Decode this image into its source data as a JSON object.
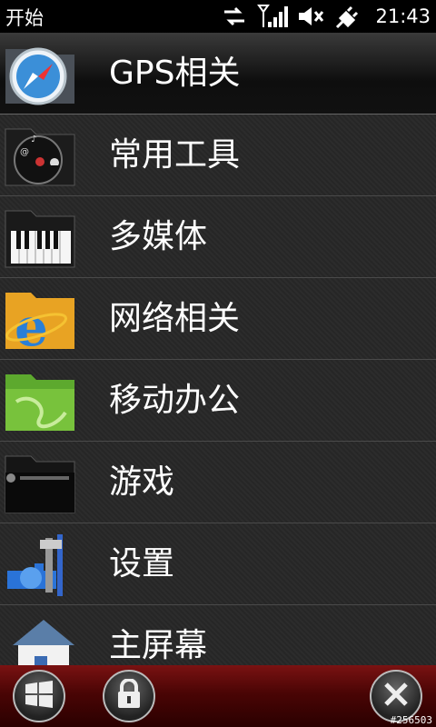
{
  "statusbar": {
    "title": "开始",
    "time": "21:43"
  },
  "menu": {
    "items": [
      {
        "label": "GPS相关",
        "icon": "safari-compass-icon",
        "selected": true
      },
      {
        "label": "常用工具",
        "icon": "dashboard-icon"
      },
      {
        "label": "多媒体",
        "icon": "piano-keyboard-icon"
      },
      {
        "label": "网络相关",
        "icon": "internet-explorer-icon"
      },
      {
        "label": "移动办公",
        "icon": "green-folder-icon"
      },
      {
        "label": "游戏",
        "icon": "game-folder-icon"
      },
      {
        "label": "设置",
        "icon": "tools-settings-icon"
      },
      {
        "label": "主屏幕",
        "icon": "home-icon"
      }
    ]
  },
  "softkeys": {
    "left": "windows-start-icon",
    "middle": "lock-icon",
    "right": "close-icon"
  },
  "watermark": "#256503"
}
